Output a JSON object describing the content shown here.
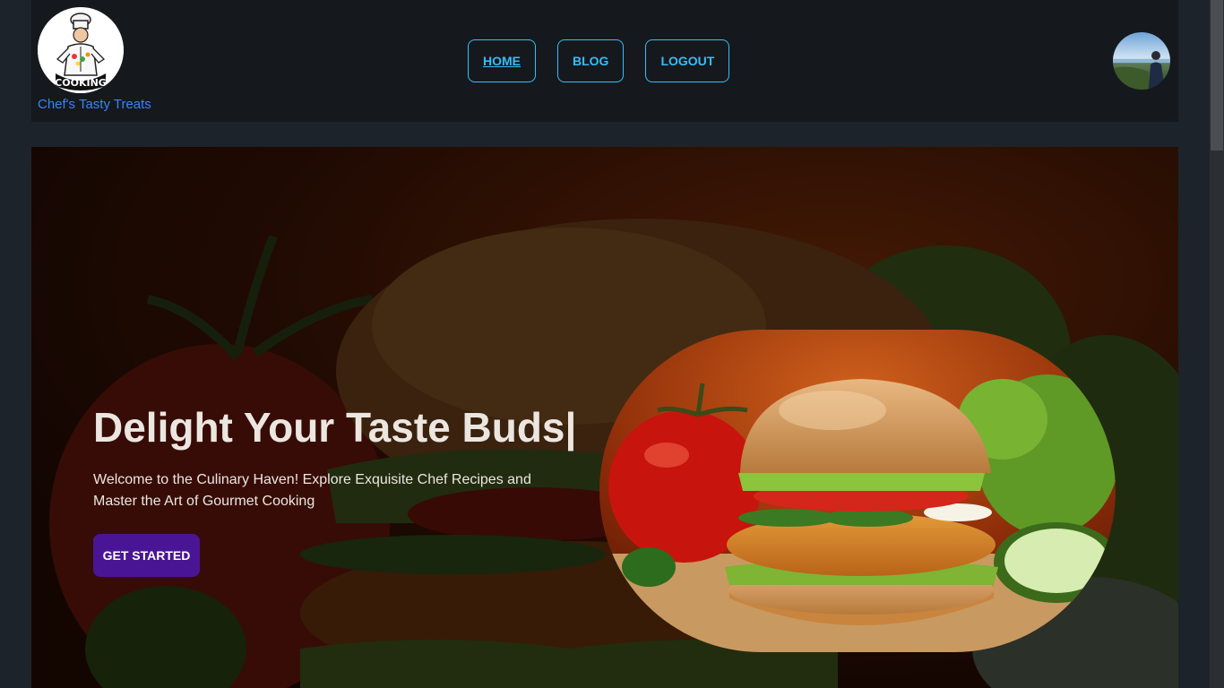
{
  "brand": {
    "name": "Chef's Tasty Treats",
    "logo_text": "COOKING",
    "logo_icon": "chef-cooking-logo"
  },
  "nav": {
    "items": [
      {
        "label": "HOME",
        "active": true
      },
      {
        "label": "BLOG",
        "active": false
      },
      {
        "label": "LOGOUT",
        "active": false
      }
    ]
  },
  "user": {
    "avatar_icon": "user-avatar-photo"
  },
  "hero": {
    "title": "Delight Your Taste Buds",
    "cursor": "|",
    "subtitle": "Welcome to the Culinary Haven! Explore Exquisite Chef Recipes and Master the Art of Gourmet Cooking",
    "cta_label": "GET STARTED",
    "image_icon": "burger-image",
    "background_icon": "burger-background-image"
  },
  "colors": {
    "page_bg": "#1d232a",
    "navbar_bg": "#15191e",
    "nav_accent": "#38bdf8",
    "brand_text": "#3b82f6",
    "cta_bg": "#4a1595"
  }
}
